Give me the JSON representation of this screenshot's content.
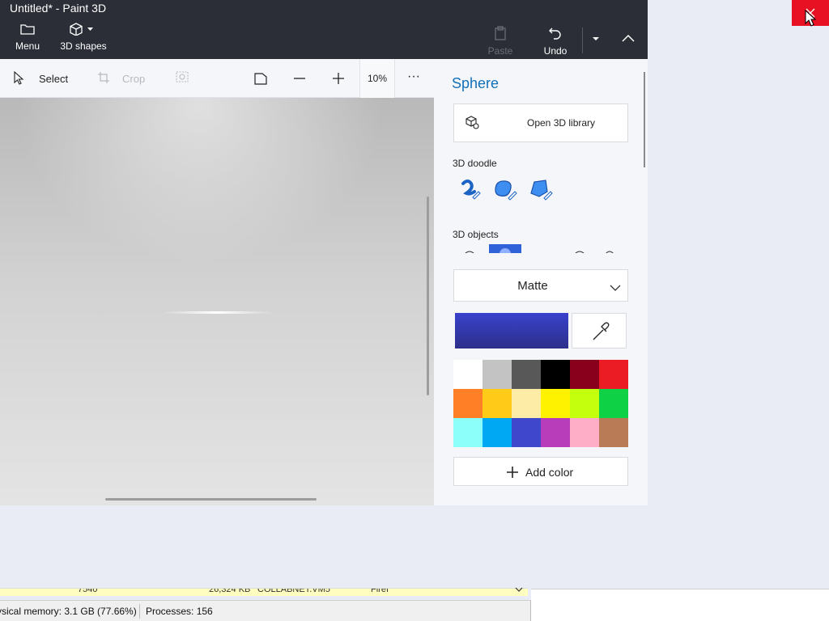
{
  "window": {
    "title": "Untitled* - Paint 3D"
  },
  "topbar": {
    "menu_label": "Menu",
    "shapes_label": "3D shapes",
    "paste_label": "Paste",
    "undo_label": "Undo"
  },
  "toolbar": {
    "select_label": "Select",
    "crop_label": "Crop",
    "zoom_value": "10%",
    "more_label": "···"
  },
  "panel": {
    "title": "Sphere",
    "library_label": "Open 3D library",
    "doodle_label": "3D doodle",
    "objects_label": "3D objects",
    "finish_value": "Matte",
    "current_color": "#3a42cc",
    "add_color_label": "Add color",
    "palette": [
      "#ffffff",
      "#c3c3c3",
      "#585858",
      "#000000",
      "#88001b",
      "#ec1c24",
      "#ff7f27",
      "#ffca18",
      "#fdeca6",
      "#fff200",
      "#c4ff0e",
      "#0ed145",
      "#8cfffb",
      "#00a8f3",
      "#3f48cc",
      "#b83dba",
      "#ffaec8",
      "#b97a56"
    ]
  },
  "statusbar": {
    "memory": "ysical memory: 3.1 GB (77.66%)",
    "processes": "Processes: 156"
  },
  "background_row": {
    "col1": "7540",
    "col2": "26,324 KB",
    "col3": "COLLABNET.VM5",
    "col4": "Firef"
  },
  "colors": {
    "accent": "#1270b8",
    "close": "#e81123",
    "appbar": "#2b2e37"
  }
}
